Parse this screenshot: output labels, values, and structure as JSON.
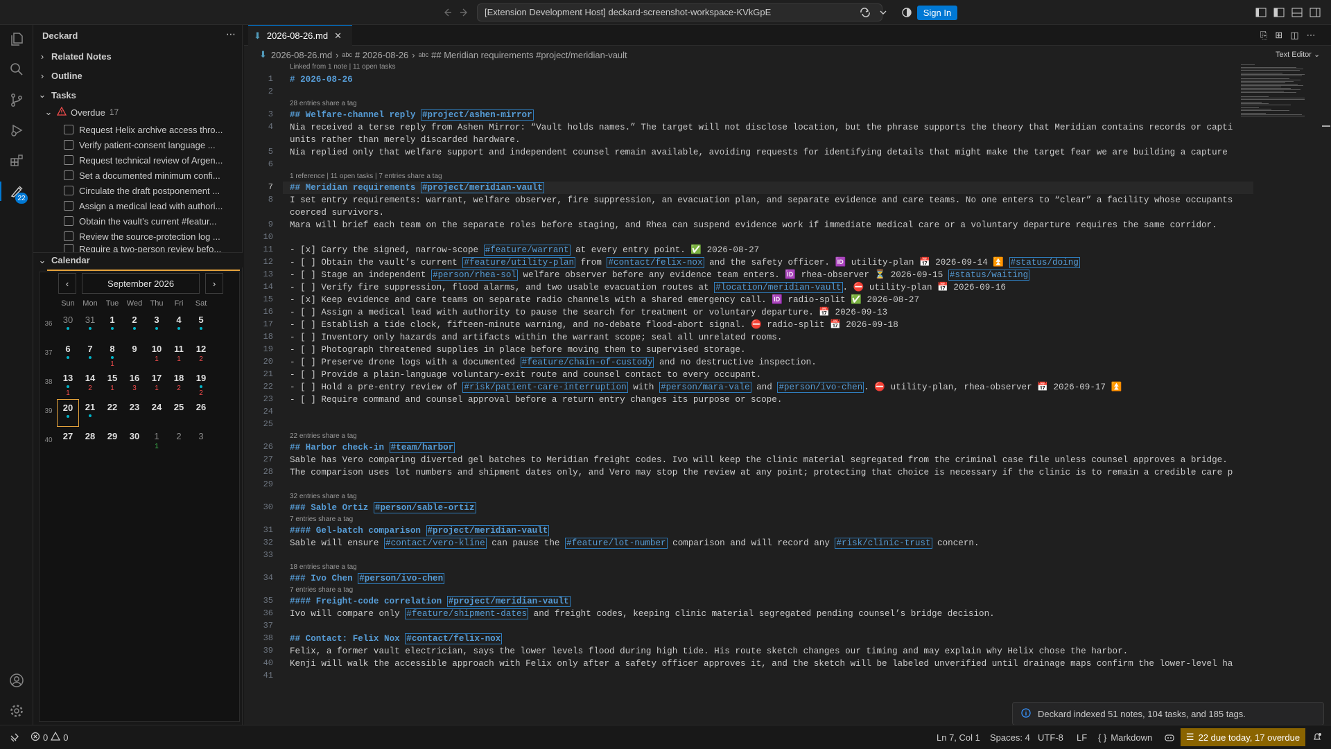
{
  "titlebar": {
    "command_center": "[Extension Development Host] deckard-screenshot-workspace-KVkGpE",
    "sign_in": "Sign In"
  },
  "activity": {
    "badge": "22"
  },
  "sidebar": {
    "title": "Deckard",
    "sections": [
      "Related Notes",
      "Outline",
      "Tasks",
      "Calendar"
    ],
    "overdue_label": "Overdue",
    "overdue_count": "17",
    "tasks": [
      "Request Helix archive access thro...",
      "Verify patient-consent language ...",
      "Request technical review of Argen...",
      "Set a documented minimum confi...",
      "Circulate the draft postponement ...",
      "Assign a medical lead with authori...",
      "Obtain the vault’s current #featur...",
      "Review the source-protection log ...",
      "Require a two-person review befo..."
    ],
    "calendar": {
      "month": "September 2026",
      "prev": "‹",
      "next": "›",
      "dow": [
        "Sun",
        "Mon",
        "Tue",
        "Wed",
        "Thu",
        "Fri",
        "Sat"
      ],
      "weeks": [
        "36",
        "37",
        "38",
        "39",
        "40"
      ],
      "days": [
        [
          "30",
          "31",
          "1",
          "2",
          "3",
          "4",
          "5"
        ],
        [
          "6",
          "7",
          "8",
          "9",
          "10",
          "11",
          "12"
        ],
        [
          "13",
          "14",
          "15",
          "16",
          "17",
          "18",
          "19"
        ],
        [
          "20",
          "21",
          "22",
          "23",
          "24",
          "25",
          "26"
        ],
        [
          "27",
          "28",
          "29",
          "30",
          "1",
          "2",
          "3"
        ]
      ],
      "counts": [
        [
          "",
          "",
          "",
          "",
          "",
          "",
          ""
        ],
        [
          "",
          "",
          "1",
          "",
          "1",
          "1",
          "2"
        ],
        [
          "1",
          "2",
          "1",
          "3",
          "1",
          "2",
          "2"
        ],
        [
          "",
          "",
          "",
          "",
          "",
          "",
          ""
        ],
        [
          "",
          "",
          "",
          "",
          "1",
          "",
          ""
        ]
      ]
    }
  },
  "editor": {
    "tab": "2026-08-26.md",
    "breadcrumb": [
      "2026-08-26.md",
      "# 2026-08-26",
      "## Meridian requirements #project/meridian-vault"
    ],
    "mode": "Text Editor",
    "lens0": "Linked from 1 note | 11 open tasks",
    "lines": [
      {
        "n": "1",
        "t": "# 2026-08-26",
        "h": 1
      },
      {
        "n": "2",
        "t": ""
      },
      {
        "n": "3",
        "t": "## Welfare-channel reply #project/ashen-mirror",
        "h": 1,
        "lens": "28 entries share a tag"
      },
      {
        "n": "4",
        "t": "Nia received a terse reply from Ashen Mirror: “Vault holds names.” The target will not disclose location, but the phrase supports the theory that Meridian contains records or captive"
      },
      {
        "n": "",
        "t": "units rather than merely discarded hardware."
      },
      {
        "n": "5",
        "t": "Nia replied only that welfare support and independent counsel remain available, avoiding requests for identifying details that might make the target fear we are building a capture list."
      },
      {
        "n": "6",
        "t": ""
      },
      {
        "n": "7",
        "t": "## Meridian requirements #project/meridian-vault",
        "h": 1,
        "lens": "1 reference | 11 open tasks | 7 entries share a tag",
        "cur": 1
      },
      {
        "n": "8",
        "t": "I set entry requirements: warrant, welfare observer, fire suppression, an evacuation plan, and separate evidence and care teams. No one enters to “clear” a facility whose occupants may be"
      },
      {
        "n": "",
        "t": "coerced survivors."
      },
      {
        "n": "9",
        "t": "Mara will brief each team on the separate roles before staging, and Rhea can suspend evidence work if immediate medical care or a voluntary departure requires the same corridor."
      },
      {
        "n": "10",
        "t": ""
      },
      {
        "n": "11",
        "t": "- [x] Carry the signed, narrow-scope #feature/warrant at every entry point. ✅ 2026-08-27"
      },
      {
        "n": "12",
        "t": "- [ ] Obtain the vault’s current #feature/utility-plan from #contact/felix-nox and the safety officer. 🆔 utility-plan 📅 2026-09-14 ⏫ #status/doing"
      },
      {
        "n": "13",
        "t": "- [ ] Stage an independent #person/rhea-sol welfare observer before any evidence team enters. 🆔 rhea-observer ⏳ 2026-09-15 #status/waiting"
      },
      {
        "n": "14",
        "t": "- [ ] Verify fire suppression, flood alarms, and two usable evacuation routes at #location/meridian-vault. ⛔ utility-plan 📅 2026-09-16"
      },
      {
        "n": "15",
        "t": "- [x] Keep evidence and care teams on separate radio channels with a shared emergency call. 🆔 radio-split ✅ 2026-08-27"
      },
      {
        "n": "16",
        "t": "- [ ] Assign a medical lead with authority to pause the search for treatment or voluntary departure. 📅 2026-09-13"
      },
      {
        "n": "17",
        "t": "- [ ] Establish a tide clock, fifteen-minute warning, and no-debate flood-abort signal. ⛔ radio-split 📅 2026-09-18"
      },
      {
        "n": "18",
        "t": "- [ ] Inventory only hazards and artifacts within the warrant scope; seal all unrelated rooms."
      },
      {
        "n": "19",
        "t": "- [ ] Photograph threatened supplies in place before moving them to supervised storage."
      },
      {
        "n": "20",
        "t": "- [ ] Preserve drone logs with a documented #feature/chain-of-custody and no destructive inspection."
      },
      {
        "n": "21",
        "t": "- [ ] Provide a plain-language voluntary-exit route and counsel contact to every occupant."
      },
      {
        "n": "22",
        "t": "- [ ] Hold a pre-entry review of #risk/patient-care-interruption with #person/mara-vale and #person/ivo-chen. ⛔ utility-plan, rhea-observer 📅 2026-09-17 ⏫"
      },
      {
        "n": "23",
        "t": "- [ ] Require command and counsel approval before a return entry changes its purpose or scope."
      },
      {
        "n": "24",
        "t": ""
      },
      {
        "n": "25",
        "t": ""
      },
      {
        "n": "26",
        "t": "## Harbor check-in #team/harbor",
        "h": 1,
        "lens": "22 entries share a tag"
      },
      {
        "n": "27",
        "t": "Sable has Vero comparing diverted gel batches to Meridian freight codes. Ivo will keep the clinic material segregated from the criminal case file unless counsel approves a bridge."
      },
      {
        "n": "28",
        "t": "The comparison uses lot numbers and shipment dates only, and Vero may stop the review at any point; protecting that choice is necessary if the clinic is to remain a credible care partner."
      },
      {
        "n": "29",
        "t": ""
      },
      {
        "n": "30",
        "t": "### Sable Ortiz #person/sable-ortiz",
        "h": 1,
        "lens": "32 entries share a tag"
      },
      {
        "n": "31",
        "t": "#### Gel-batch comparison #project/meridian-vault",
        "h": 1,
        "lens": "7 entries share a tag"
      },
      {
        "n": "32",
        "t": "Sable will ensure #contact/vero-kline can pause the #feature/lot-number comparison and will record any #risk/clinic-trust concern."
      },
      {
        "n": "33",
        "t": ""
      },
      {
        "n": "34",
        "t": "### Ivo Chen #person/ivo-chen",
        "h": 1,
        "lens": "18 entries share a tag"
      },
      {
        "n": "35",
        "t": "#### Freight-code correlation #project/meridian-vault",
        "h": 1,
        "lens": "7 entries share a tag"
      },
      {
        "n": "36",
        "t": "Ivo will compare only #feature/shipment-dates and freight codes, keeping clinic material segregated pending counsel’s bridge decision."
      },
      {
        "n": "37",
        "t": ""
      },
      {
        "n": "38",
        "t": "## Contact: Felix Nox #contact/felix-nox",
        "h": 1
      },
      {
        "n": "39",
        "t": "Felix, a former vault electrician, says the lower levels flood during high tide. His route sketch changes our timing and may explain why Helix chose the harbor."
      },
      {
        "n": "40",
        "t": "Kenji will walk the accessible approach with Felix only after a safety officer approves it, and the sketch will be labeled unverified until drainage maps confirm the lower-level hazards."
      },
      {
        "n": "41",
        "t": ""
      }
    ]
  },
  "toast": "Deckard indexed 51 notes, 104 tasks, and 185 tags.",
  "status": {
    "errors": "0",
    "warnings": "0",
    "position": "Ln 7, Col 1",
    "spaces": "Spaces: 4",
    "encoding": "UTF-8",
    "eol": "LF",
    "language": "Markdown",
    "due": "22 due today, 17 overdue"
  }
}
